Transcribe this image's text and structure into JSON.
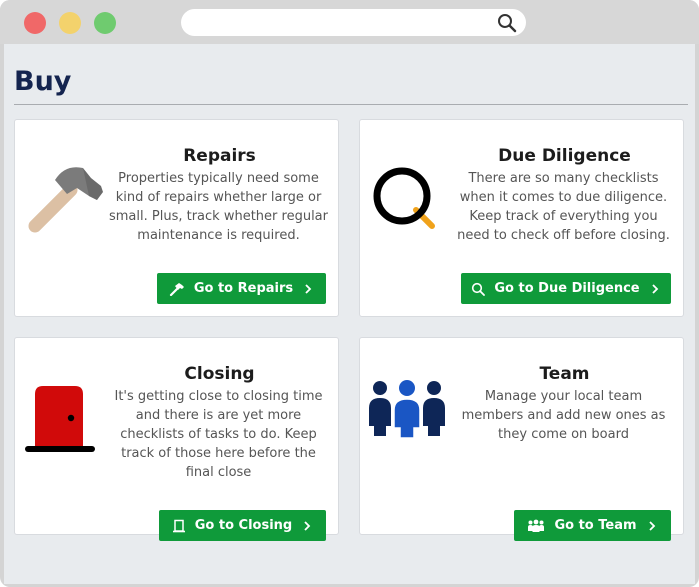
{
  "page": {
    "title": "Buy"
  },
  "cards": [
    {
      "title": "Repairs",
      "description": "Properties typically need some kind of repairs whether large or small. Plus, track whether regular maintenance is required.",
      "button_label": "Go to Repairs",
      "illustration": "hammer-icon",
      "button_icon": "hammer-icon"
    },
    {
      "title": "Due Diligence",
      "description": "There are so many checklists when it comes to due diligence. Keep track of everything you need to check off before closing.",
      "button_label": "Go to Due Diligence",
      "illustration": "magnifier-icon",
      "button_icon": "search-icon"
    },
    {
      "title": "Closing",
      "description": "It's getting close to closing time and there is are yet more checklists of tasks to do. Keep track of those here before the final close",
      "button_label": "Go to Closing",
      "illustration": "door-icon",
      "button_icon": "door-icon"
    },
    {
      "title": "Team",
      "description": "Manage your local team members and add new ones as they come on board",
      "button_label": "Go to Team",
      "illustration": "team-icon",
      "button_icon": "users-icon"
    }
  ],
  "colors": {
    "accent": "#0f9a3a",
    "title": "#14244f",
    "team_dark": "#0e2657",
    "team_light": "#1a56c4",
    "door": "#d10a0a",
    "magnifier_handle": "#f0a21a"
  }
}
